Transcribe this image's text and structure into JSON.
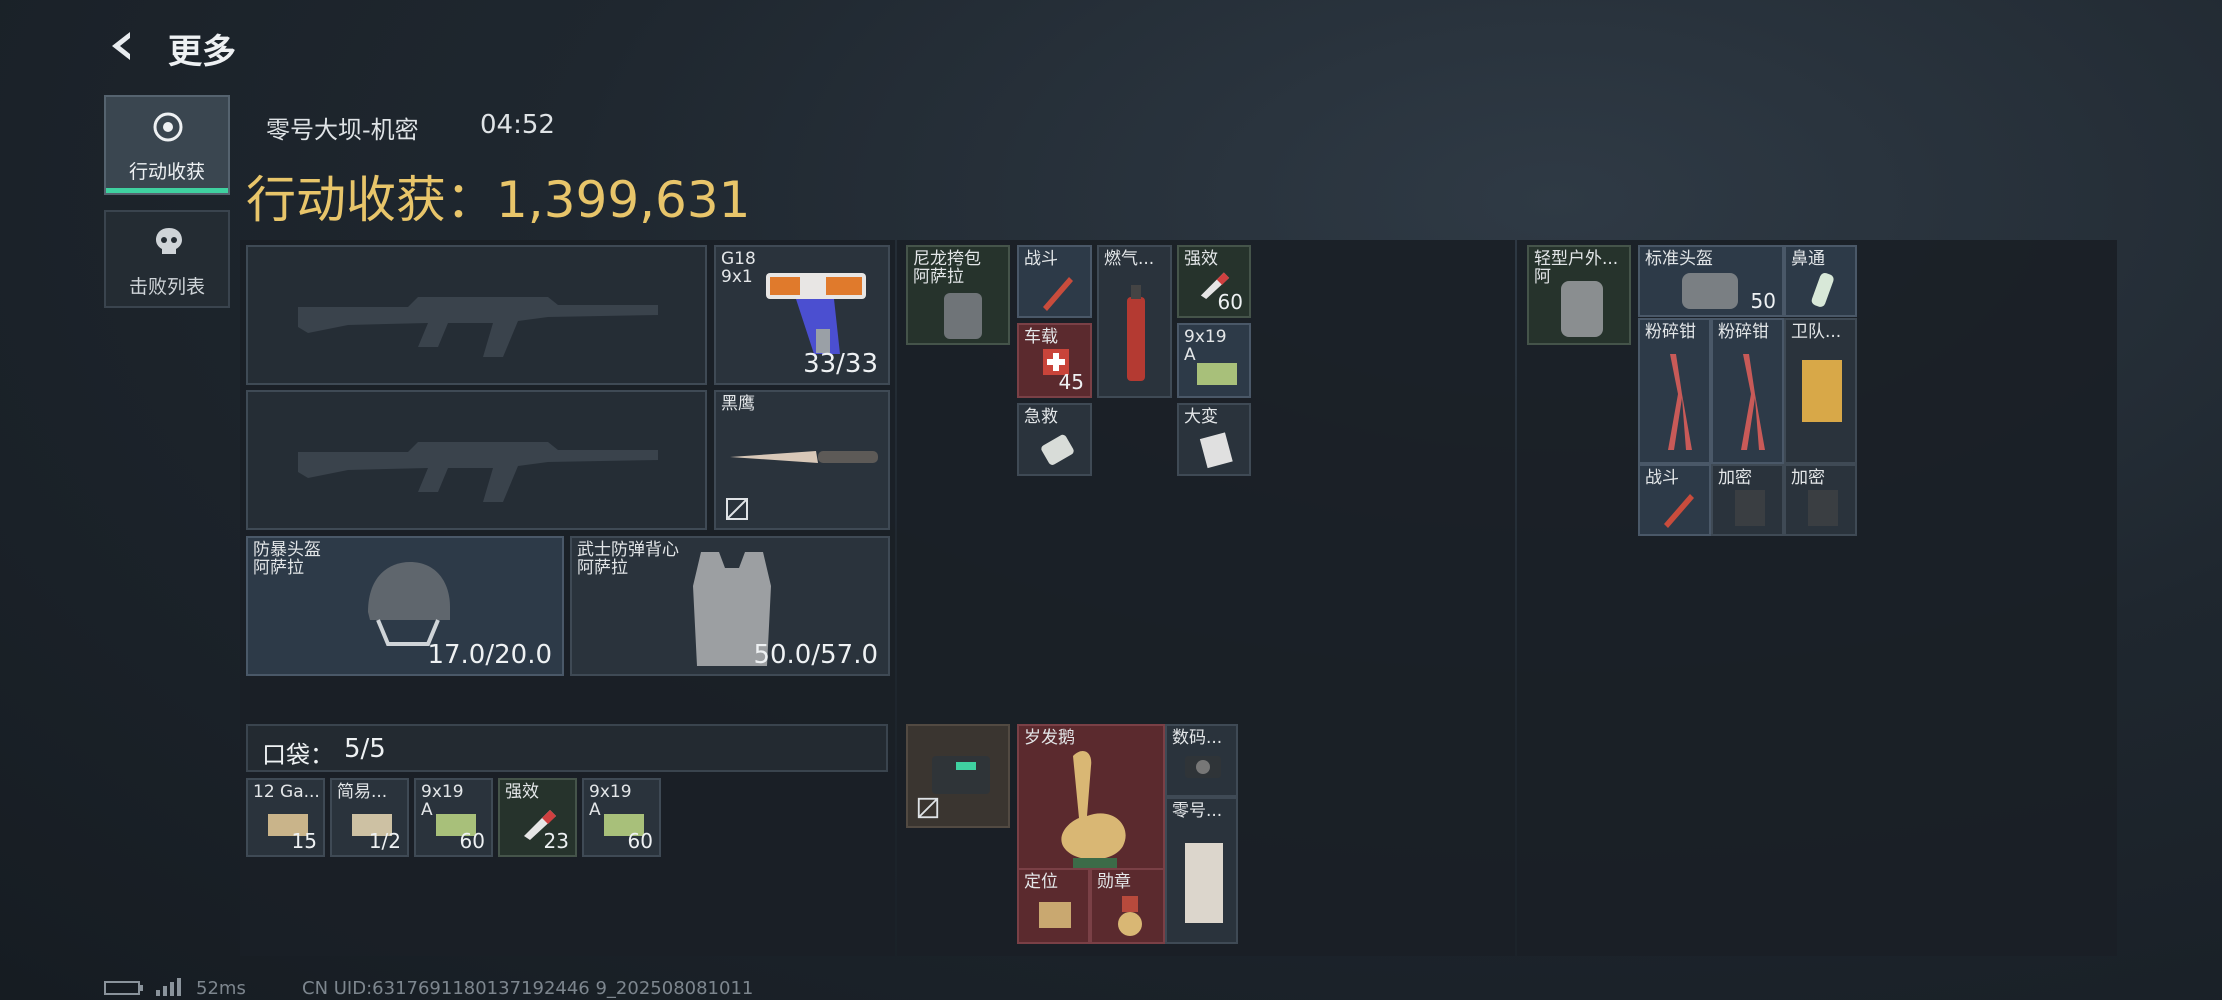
{
  "header": {
    "back_label": "更多"
  },
  "sidebar": {
    "items": [
      {
        "label": "行动收获",
        "icon": "target-icon",
        "active": true
      },
      {
        "label": "击败列表",
        "icon": "skull-icon",
        "active": false
      }
    ]
  },
  "mission": {
    "name": "零号大坝-机密",
    "time": "04:52",
    "value_label": "行动收获：",
    "value": "1,399,631"
  },
  "weapons": {
    "sidearm": {
      "label": "G18\n9x1",
      "ammo": "33/33"
    },
    "melee": {
      "label": "黑鹰"
    }
  },
  "armor": {
    "helmet": {
      "label": "防暴头盔\n阿萨拉",
      "durability": "17.0/20.0"
    },
    "vest": {
      "label": "武士防弹背心\n阿萨拉",
      "durability": "50.0/57.0"
    }
  },
  "pocket": {
    "title": "口袋：",
    "count": "5/5",
    "items": [
      {
        "label": "12 Ga...",
        "count": "15"
      },
      {
        "label": "简易...",
        "count": "1/2"
      },
      {
        "label": "9x19\nA",
        "count": "60"
      },
      {
        "label": "强效",
        "count": "23"
      },
      {
        "label": "9x19\nA",
        "count": "60"
      }
    ]
  },
  "chest_rig": {
    "label": "尼龙挎包\n阿萨拉",
    "items": [
      {
        "label": "战斗"
      },
      {
        "label": "燃气..."
      },
      {
        "label": "强效",
        "count": "60"
      },
      {
        "label": "车载",
        "count": "45"
      },
      {
        "label": "9x19\nA"
      },
      {
        "label": "急救"
      },
      {
        "label": "大変"
      }
    ]
  },
  "safebox": {
    "items": [
      {
        "label": "岁发鹅"
      },
      {
        "label": "数码..."
      },
      {
        "label": "零号..."
      },
      {
        "label": "定位"
      },
      {
        "label": "勋章"
      }
    ]
  },
  "backpack": {
    "label": "轻型户外...\n阿",
    "items": [
      {
        "label": "标准头盔",
        "count": "50"
      },
      {
        "label": "鼻通"
      },
      {
        "label": "粉碎钳"
      },
      {
        "label": "粉碎钳"
      },
      {
        "label": "卫队..."
      },
      {
        "label": "战斗"
      },
      {
        "label": "加密"
      },
      {
        "label": "加密"
      }
    ]
  },
  "footer": {
    "ping": "52ms",
    "uid": "CN UID:6317691180137192446 9_202508081011"
  },
  "colors": {
    "accent": "#e8c56a",
    "active_tab": "#3fd1a0"
  }
}
